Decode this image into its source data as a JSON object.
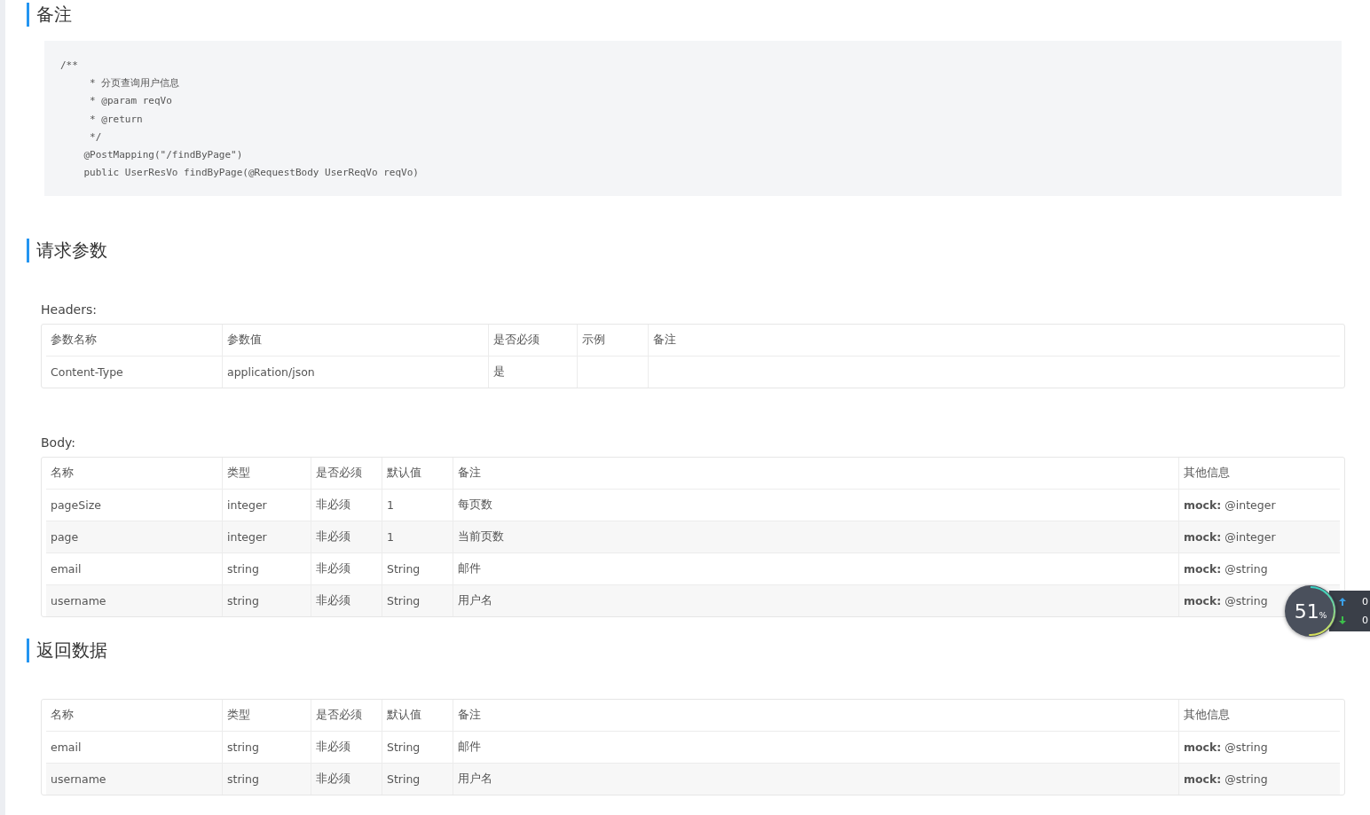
{
  "remarks": {
    "title": "备注",
    "code_lines": [
      "/**",
      "     * 分页查询用户信息",
      "     * @param reqVo",
      "     * @return",
      "     */",
      "    @PostMapping(\"/findByPage\")",
      "    public UserResVo findByPage(@RequestBody UserReqVo reqVo)"
    ]
  },
  "request": {
    "title": "请求参数",
    "headers": {
      "label": "Headers:",
      "columns": [
        "参数名称",
        "参数值",
        "是否必须",
        "示例",
        "备注"
      ],
      "rows": [
        {
          "cells": [
            "Content-Type",
            "application/json",
            "是",
            "",
            ""
          ]
        }
      ]
    },
    "body": {
      "label": "Body:",
      "columns": [
        "名称",
        "类型",
        "是否必须",
        "默认值",
        "备注",
        "其他信息"
      ],
      "rows": [
        {
          "cells": [
            "pageSize",
            "integer",
            "非必须",
            "1",
            "每页数",
            "**mock:** @integer"
          ]
        },
        {
          "cells": [
            "page",
            "integer",
            "非必须",
            "1",
            "当前页数",
            "**mock:** @integer"
          ]
        },
        {
          "cells": [
            "email",
            "string",
            "非必须",
            "String",
            "邮件",
            "**mock:** @string"
          ]
        },
        {
          "cells": [
            "username",
            "string",
            "非必须",
            "String",
            "用户名",
            "**mock:** @string"
          ]
        }
      ]
    }
  },
  "response": {
    "title": "返回数据",
    "table": {
      "columns": [
        "名称",
        "类型",
        "是否必须",
        "默认值",
        "备注",
        "其他信息"
      ],
      "rows": [
        {
          "cells": [
            "email",
            "string",
            "非必须",
            "String",
            "邮件",
            "**mock:** @string"
          ]
        },
        {
          "cells": [
            "username",
            "string",
            "非必须",
            "String",
            "用户名",
            "**mock:** @string"
          ]
        }
      ]
    }
  },
  "speed_widget": {
    "percent": "51",
    "unit": "%",
    "upload": "0",
    "download": "0",
    "level": 0.51
  }
}
